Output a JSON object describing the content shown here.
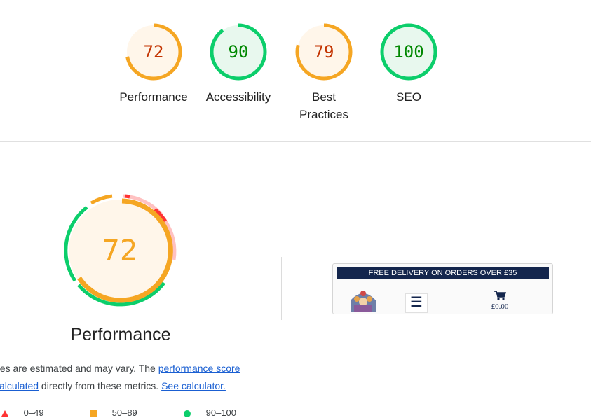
{
  "categories": [
    {
      "label": "Performance",
      "score": 72,
      "fraction": 0.72,
      "color": "#f5a623",
      "text_color": "#c33300",
      "bg": "#fff6ea"
    },
    {
      "label": "Accessibility",
      "score": 90,
      "fraction": 0.9,
      "color": "#0cce6b",
      "text_color": "#008800",
      "bg": "#e8f8ee"
    },
    {
      "label": "Best Practices",
      "score": 79,
      "fraction": 0.79,
      "color": "#f5a623",
      "text_color": "#c33300",
      "bg": "#fff6ea"
    },
    {
      "label": "SEO",
      "score": 100,
      "fraction": 1.0,
      "color": "#0cce6b",
      "text_color": "#008800",
      "bg": "#e8f8ee"
    }
  ],
  "performance": {
    "score": "72",
    "title": "Performance",
    "desc_lead": "ues are estimated and may vary. The ",
    "link_score": "performance score",
    "link_calc_lead": " calculated",
    "desc_mid": " directly from these metrics. ",
    "link_calculator": "See calculator."
  },
  "thumbnail": {
    "banner": "FREE DELIVERY ON ORDERS OVER £35",
    "price": "£0.00",
    "menu_icon": "hamburger-menu-icon",
    "cart_icon": "shopping-cart-icon"
  },
  "legend": [
    {
      "range": "0–49",
      "icon": "triangle-icon",
      "color": "#ff3333"
    },
    {
      "range": "50–89",
      "icon": "square-icon",
      "color": "#f5a623"
    },
    {
      "range": "90–100",
      "icon": "circle-icon",
      "color": "#0cce6b"
    }
  ]
}
